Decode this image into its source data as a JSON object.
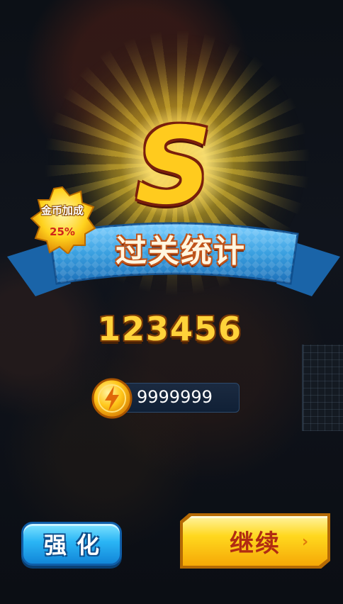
{
  "result": {
    "rank": "S",
    "title": "过关统计",
    "score": "123456",
    "coins": "9999999"
  },
  "bonus_badge": {
    "label": "金币加成",
    "percent": "25%"
  },
  "buttons": {
    "strengthen": "强化",
    "continue": "继续"
  },
  "colors": {
    "ribbon": "#3aa0e0",
    "gold": "#ffcb1e",
    "button_blue": "#2ab5f5",
    "button_yellow": "#ffd81e"
  },
  "icons": [
    "coin-icon",
    "chevron-right-icon",
    "star-badge-icon"
  ]
}
